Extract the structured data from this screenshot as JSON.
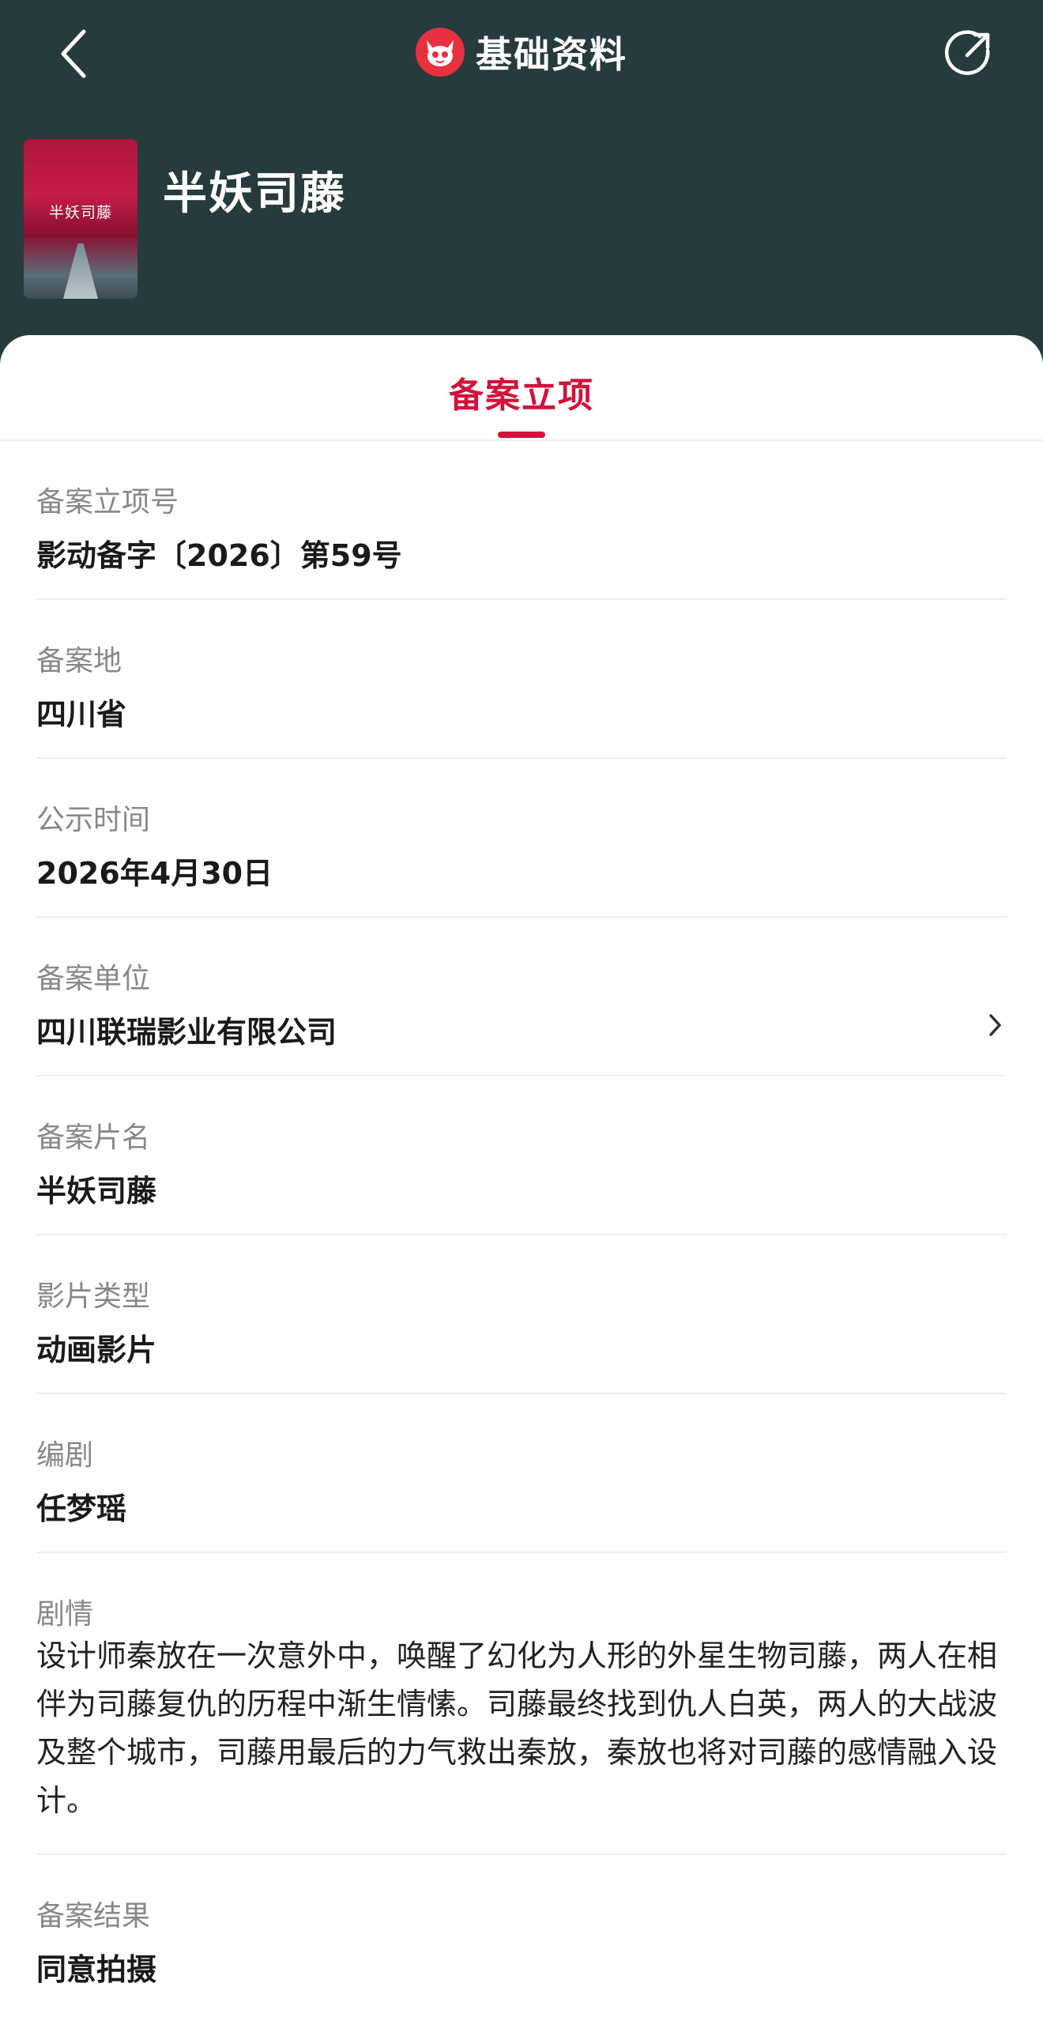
{
  "header": {
    "title": "基础资料",
    "back_icon": "chevron-left-icon",
    "share_icon": "share-icon",
    "logo_icon": "cat-logo-icon",
    "background": "#263b3b"
  },
  "movie": {
    "title": "半妖司藤",
    "poster_text": "半妖司藤"
  },
  "tabs": {
    "active_label": "备案立项",
    "accent_color": "#d2123a"
  },
  "fields": [
    {
      "label": "备案立项号",
      "value": "影动备字〔2026〕第59号"
    },
    {
      "label": "备案地",
      "value": "四川省"
    },
    {
      "label": "公示时间",
      "value": "2026年4月30日"
    },
    {
      "label": "备案单位",
      "value": "四川联瑞影业有限公司",
      "icon": "chevron-right-icon"
    },
    {
      "label": "备案片名",
      "value": "半妖司藤"
    },
    {
      "label": "影片类型",
      "value": "动画影片"
    },
    {
      "label": "编剧",
      "value": "任梦瑶"
    },
    {
      "label": "剧情",
      "value": "设计师秦放在一次意外中，唤醒了幻化为人形的外星生物司藤，两人在相伴为司藤复仇的历程中渐生情愫。司藤最终找到仇人白英，两人的大战波及整个城市，司藤用最后的力气救出秦放，秦放也将对司藤的感情融入设计。"
    },
    {
      "label": "备案结果",
      "value": "同意拍摄"
    }
  ]
}
